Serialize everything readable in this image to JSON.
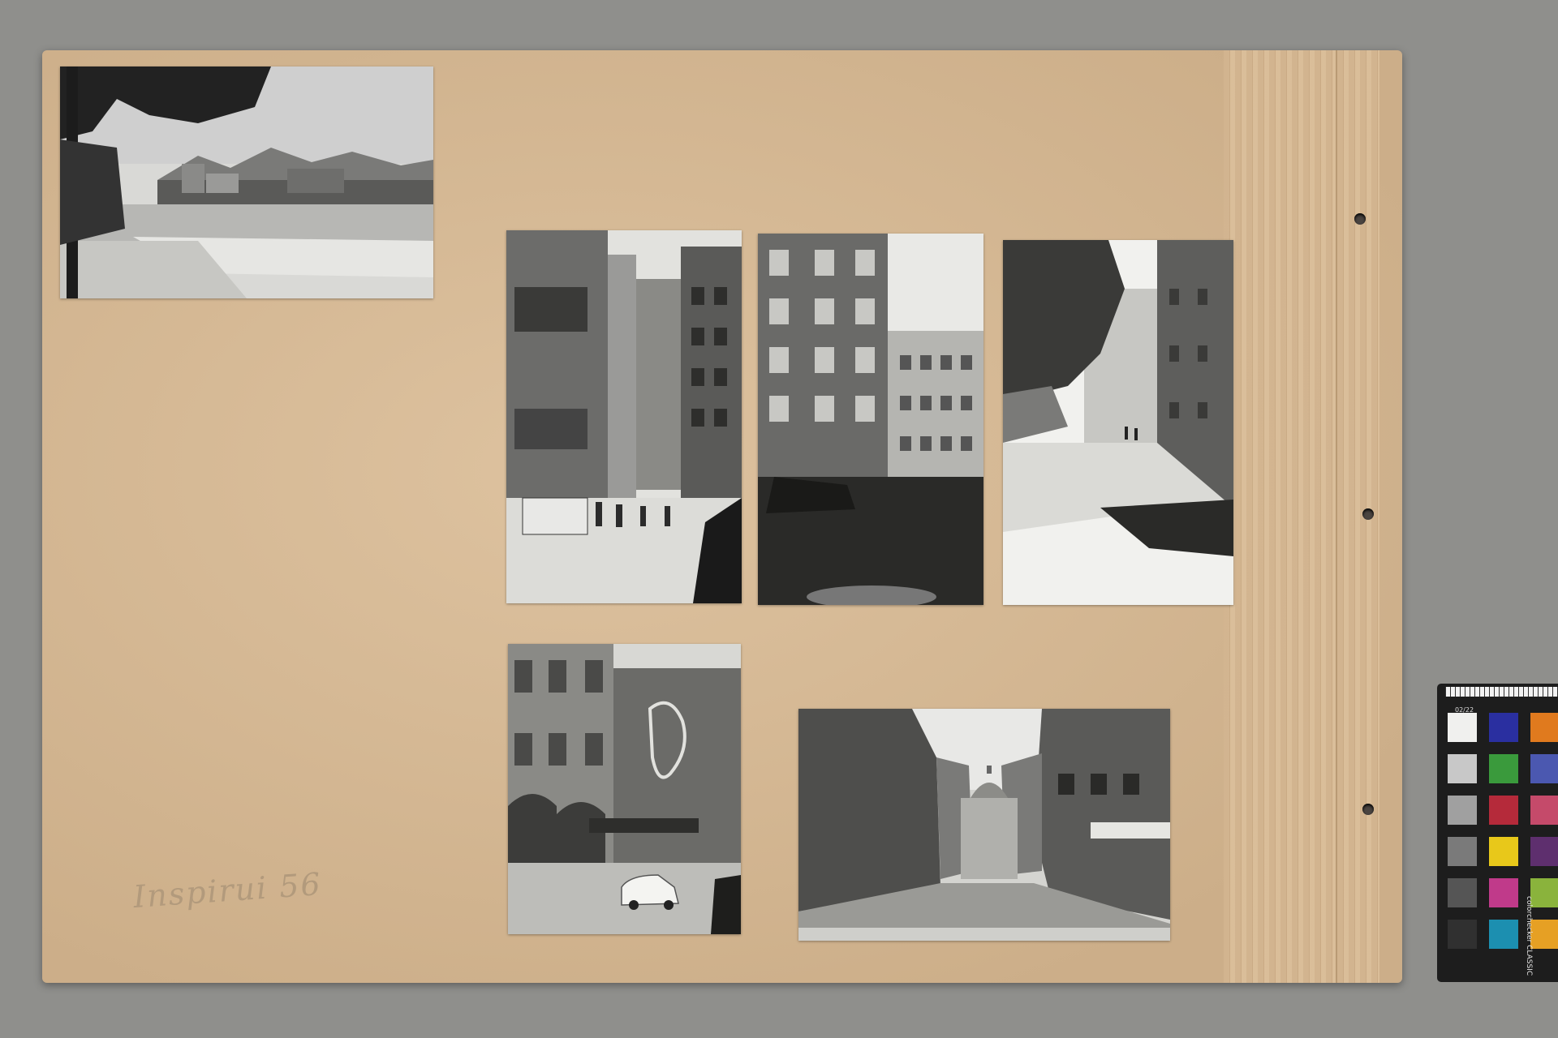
{
  "album_page": {
    "caption": "Inspirui 56",
    "photos": [
      {
        "name": "photo-river-mountains",
        "subject": "river-embankment-trees"
      },
      {
        "name": "photo-golden-roof-street",
        "subject": "street-with-van"
      },
      {
        "name": "photo-helblinghaus",
        "subject": "ornate-facade"
      },
      {
        "name": "photo-sunlit-lane",
        "subject": "lane-with-tree"
      },
      {
        "name": "photo-hotel-street",
        "subject": "hotel-with-car"
      },
      {
        "name": "photo-michaelertor-street",
        "subject": "street-to-dome"
      }
    ]
  },
  "colorchecker": {
    "label": "colorchecker CLASSIC",
    "ruler_label": "02/22",
    "swatch_colors": [
      [
        "#f0f0ee",
        "#2a2fa0",
        "#e07a1e"
      ],
      [
        "#c8c8c8",
        "#3a9a3c",
        "#4b58b0"
      ],
      [
        "#a0a0a0",
        "#b52a3a",
        "#c54a6a"
      ],
      [
        "#7a7a7a",
        "#e8c81a",
        "#5e2f6e"
      ],
      [
        "#555555",
        "#c03a8a",
        "#8ab33c"
      ],
      [
        "#303030",
        "#1c8fb0",
        "#e6a024"
      ]
    ]
  }
}
